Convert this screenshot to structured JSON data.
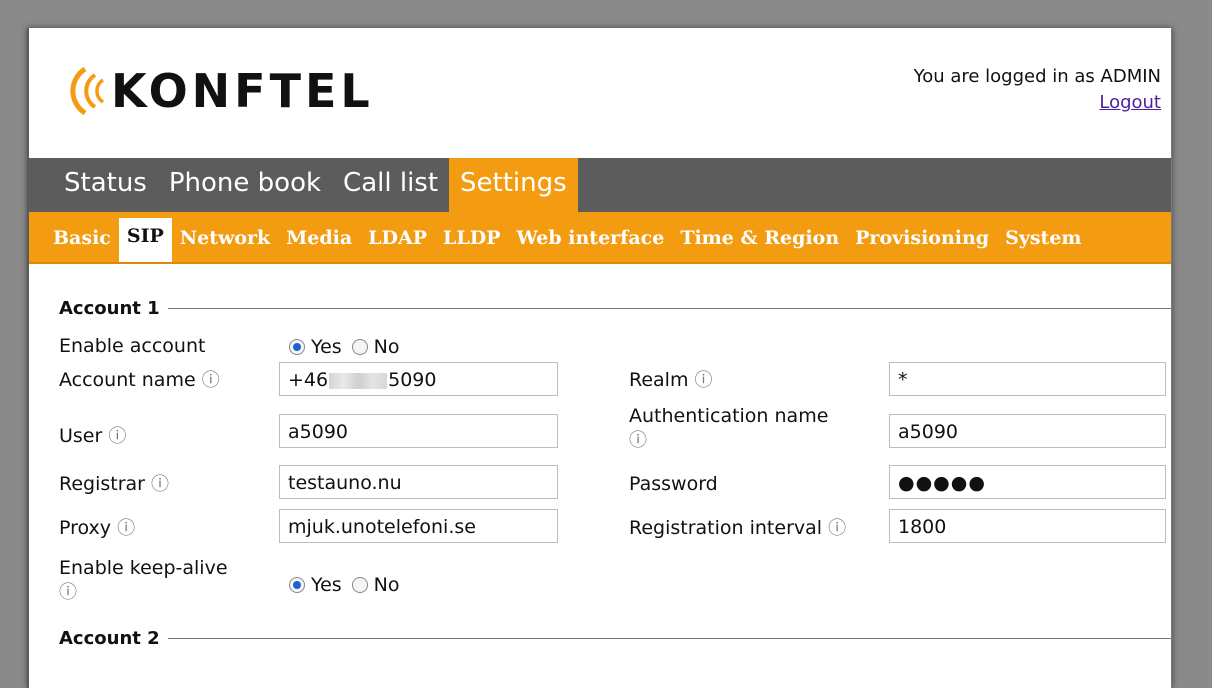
{
  "header": {
    "logo_text": "KONFTEL",
    "login_text": "You are logged in as ADMIN",
    "logout_label": "Logout"
  },
  "main_nav": [
    {
      "label": "Status",
      "active": false
    },
    {
      "label": "Phone book",
      "active": false
    },
    {
      "label": "Call list",
      "active": false
    },
    {
      "label": "Settings",
      "active": true
    }
  ],
  "sub_nav": [
    {
      "label": "Basic",
      "active": false
    },
    {
      "label": "SIP",
      "active": true
    },
    {
      "label": "Network",
      "active": false
    },
    {
      "label": "Media",
      "active": false
    },
    {
      "label": "LDAP",
      "active": false
    },
    {
      "label": "LLDP",
      "active": false
    },
    {
      "label": "Web interface",
      "active": false
    },
    {
      "label": "Time & Region",
      "active": false
    },
    {
      "label": "Provisioning",
      "active": false
    },
    {
      "label": "System",
      "active": false
    }
  ],
  "account1": {
    "title": "Account 1",
    "enable_account": {
      "label": "Enable account",
      "yes": "Yes",
      "no": "No",
      "selected": "Yes"
    },
    "account_name": {
      "label": "Account name",
      "value_prefix": "+46",
      "value_suffix": "5090"
    },
    "user": {
      "label": "User",
      "value": "a5090"
    },
    "registrar": {
      "label": "Registrar",
      "value": "testauno.nu"
    },
    "proxy": {
      "label": "Proxy",
      "value": "mjuk.unotelefoni.se"
    },
    "keep_alive": {
      "label": "Enable keep-alive",
      "yes": "Yes",
      "no": "No",
      "selected": "Yes"
    },
    "realm": {
      "label": "Realm",
      "value": "*"
    },
    "auth_name": {
      "label": "Authentication name",
      "value": "a5090"
    },
    "password": {
      "label": "Password",
      "value": "●●●●●"
    },
    "reg_interval": {
      "label": "Registration interval",
      "value": "1800"
    }
  },
  "account2": {
    "title": "Account 2"
  },
  "icons": {
    "info": "ⓘ"
  },
  "colors": {
    "accent": "#f39c12",
    "nav_bg": "#5c5c5c",
    "radio_selected": "#1f5fd1"
  }
}
